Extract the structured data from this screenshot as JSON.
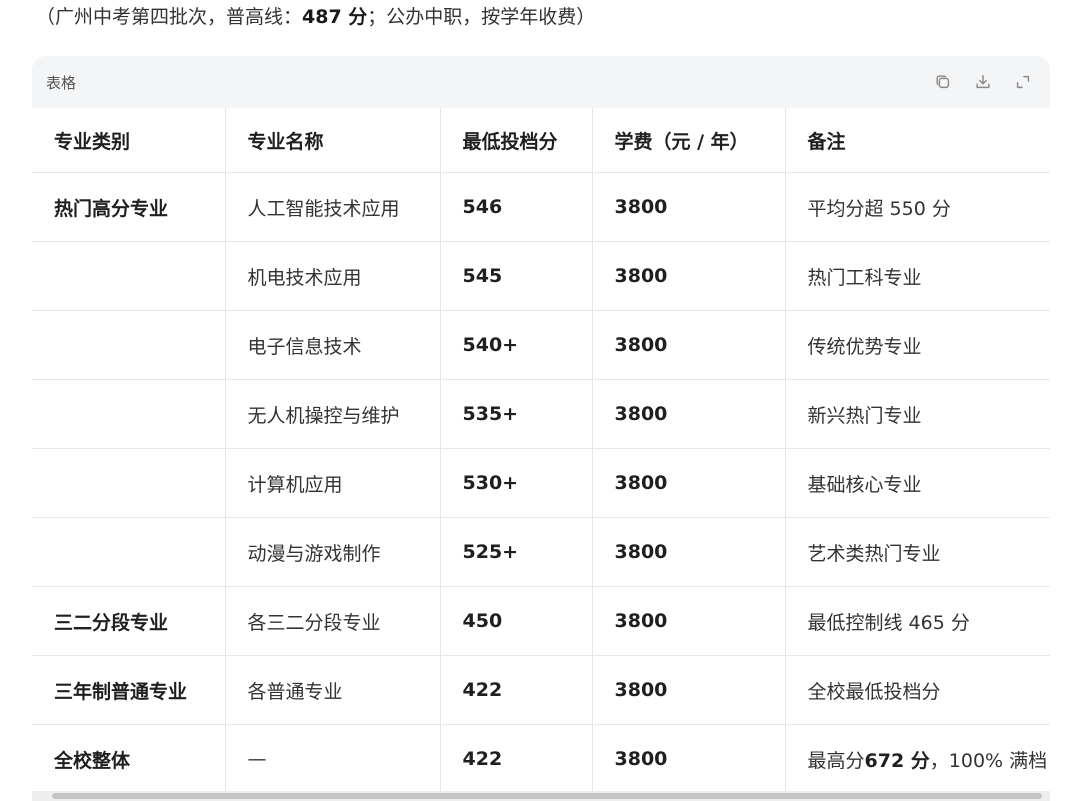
{
  "intro": {
    "prefix": "（广州中考第四批次，普高线：",
    "score": "487 分",
    "suffix": "；公办中职，按学年收费）"
  },
  "table_card": {
    "title": "表格",
    "tools": [
      "copy-icon",
      "download-icon",
      "expand-icon"
    ],
    "headers": [
      "专业类别",
      "专业名称",
      "最低投档分",
      "学费（元 / 年）",
      "备注"
    ],
    "rows": [
      {
        "category": "热门高分专业",
        "name": "人工智能技术应用",
        "min_score": "546",
        "tuition": "3800",
        "note": "平均分超 550 分"
      },
      {
        "category": "",
        "name": "机电技术应用",
        "min_score": "545",
        "tuition": "3800",
        "note": "热门工科专业"
      },
      {
        "category": "",
        "name": "电子信息技术",
        "min_score": "540+",
        "tuition": "3800",
        "note": "传统优势专业"
      },
      {
        "category": "",
        "name": "无人机操控与维护",
        "min_score": "535+",
        "tuition": "3800",
        "note": "新兴热门专业"
      },
      {
        "category": "",
        "name": "计算机应用",
        "min_score": "530+",
        "tuition": "3800",
        "note": "基础核心专业"
      },
      {
        "category": "",
        "name": "动漫与游戏制作",
        "min_score": "525+",
        "tuition": "3800",
        "note": "艺术类热门专业"
      },
      {
        "category": "三二分段专业",
        "name": "各三二分段专业",
        "min_score": "450",
        "tuition": "3800",
        "note": "最低控制线 465 分"
      },
      {
        "category": "三年制普通专业",
        "name": "各普通专业",
        "min_score": "422",
        "tuition": "3800",
        "note": "全校最低投档分"
      },
      {
        "category": "全校整体",
        "name": "—",
        "min_score": "422",
        "tuition": "3800",
        "note": ""
      }
    ],
    "last_note": {
      "prefix": "最高分",
      "bold": "672 分",
      "suffix": "，100% 满档"
    }
  }
}
